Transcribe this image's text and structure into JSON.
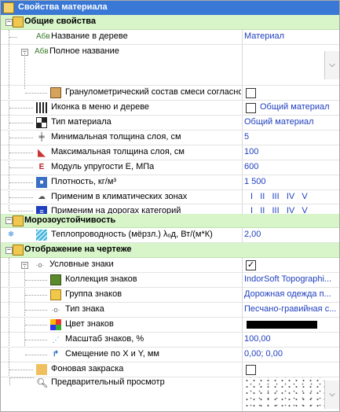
{
  "title": "Свойства материала",
  "cat_general": "Общие свойства",
  "cat_frost": "Морозоустойчивость",
  "cat_display": "Отображение на чертеже",
  "abv_text": "Абв",
  "name_label": "Название в дереве",
  "name_value": "Материал",
  "full_name_label": "Полное название",
  "grading_label": "Гранулометрический состав смеси согласно",
  "icon_label": "Иконка в меню и дереве",
  "icon_value": "Общий материал",
  "type_label": "Тип материала",
  "type_value": "Общий материал",
  "min_label": "Минимальная толщина слоя, см",
  "min_value": "5",
  "max_label": "Максимальная толщина слоя, см",
  "max_value": "100",
  "mod_label": "Модуль упругости E, МПа",
  "mod_value": "600",
  "dens_label": "Плотность, кг/м³",
  "dens_value": "1 500",
  "zones_label": "Применим в климатических зонах",
  "zones_value": "I   II   III   IV   V",
  "roads_label": "Применим на дорогах категорий",
  "roads_value": "I   II   III   IV   V",
  "therm_label": "Теплопроводность (мёрзл.) λₒд, Вт/(м*К)",
  "therm_value": "2,00",
  "signs_label": "Условные знаки",
  "coll_label": "Коллекция знаков",
  "coll_value": "IndorSoft Topographi...",
  "group_label": "Группа знаков",
  "group_value": "Дорожная одежда п...",
  "stype_label": "Тип знака",
  "stype_value": "Песчано-гравийная с...",
  "color_label": "Цвет знаков",
  "scale_label": "Масштаб знаков, %",
  "scale_value": "100,00",
  "shift_label": "Смещение по X и Y, мм",
  "shift_value": "0,00; 0,00",
  "bg_label": "Фоновая закраска",
  "preview_label": "Предварительный просмотр",
  "colors": {
    "title_bg": "#3a78d6",
    "category_bg": "#d7f5c9",
    "value_text": "#1f3fbf"
  }
}
